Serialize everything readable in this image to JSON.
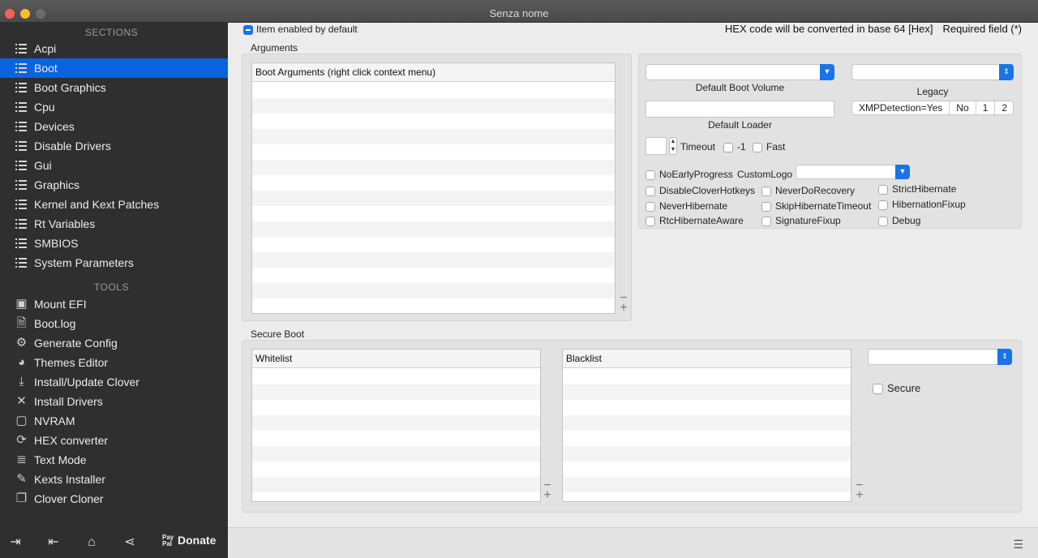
{
  "window": {
    "title": "Senza nome"
  },
  "sidebar": {
    "sections_header": "SECTIONS",
    "tools_header": "TOOLS",
    "sections": [
      {
        "label": "Acpi"
      },
      {
        "label": "Boot"
      },
      {
        "label": "Boot Graphics"
      },
      {
        "label": "Cpu"
      },
      {
        "label": "Devices"
      },
      {
        "label": "Disable Drivers"
      },
      {
        "label": "Gui"
      },
      {
        "label": "Graphics"
      },
      {
        "label": "Kernel and Kext Patches"
      },
      {
        "label": "Rt Variables"
      },
      {
        "label": "SMBIOS"
      },
      {
        "label": "System Parameters"
      }
    ],
    "tools": [
      {
        "label": "Mount EFI",
        "icon": "disk-icon"
      },
      {
        "label": "Boot.log",
        "icon": "log-icon"
      },
      {
        "label": "Generate Config",
        "icon": "gears-icon"
      },
      {
        "label": "Themes Editor",
        "icon": "palette-icon"
      },
      {
        "label": "Install/Update Clover",
        "icon": "download-icon"
      },
      {
        "label": "Install Drivers",
        "icon": "tools-icon"
      },
      {
        "label": "NVRAM",
        "icon": "chip-icon"
      },
      {
        "label": "HEX converter",
        "icon": "refresh-icon"
      },
      {
        "label": "Text Mode",
        "icon": "text-icon"
      },
      {
        "label": "Kexts Installer",
        "icon": "plug-icon"
      },
      {
        "label": "Clover Cloner",
        "icon": "copy-icon"
      }
    ],
    "bottom": {
      "donate_label": "Donate",
      "paypal_text": "Pay Pal"
    }
  },
  "main": {
    "item_enabled_label": "Item enabled by default",
    "hex_note": "HEX code will be converted in base 64 [Hex]",
    "required_note": "Required field (*)",
    "arguments": {
      "group_title": "Arguments",
      "table_header": "Boot Arguments (right click context menu)"
    },
    "boot": {
      "default_boot_volume_label": "Default Boot Volume",
      "legacy_label": "Legacy",
      "default_loader_label": "Default Loader",
      "segmented": [
        "XMPDetection=Yes",
        "No",
        "1",
        "2"
      ],
      "timeout_label": "Timeout",
      "minus_one_label": "-1",
      "fast_label": "Fast",
      "no_early_progress": "NoEarlyProgress",
      "custom_logo": "CustomLogo",
      "options": [
        "DisableCloverHotkeys",
        "NeverDoRecovery",
        "StrictHibernate",
        "NeverHibernate",
        "SkipHibernateTimeout",
        "HibernationFixup",
        "RtcHibernateAware",
        "SignatureFixup",
        "Debug"
      ]
    },
    "secure_boot": {
      "group_title": "Secure Boot",
      "whitelist_header": "Whitelist",
      "blacklist_header": "Blacklist",
      "secure_label": "Secure"
    },
    "accent_color": "#0a63e0"
  }
}
